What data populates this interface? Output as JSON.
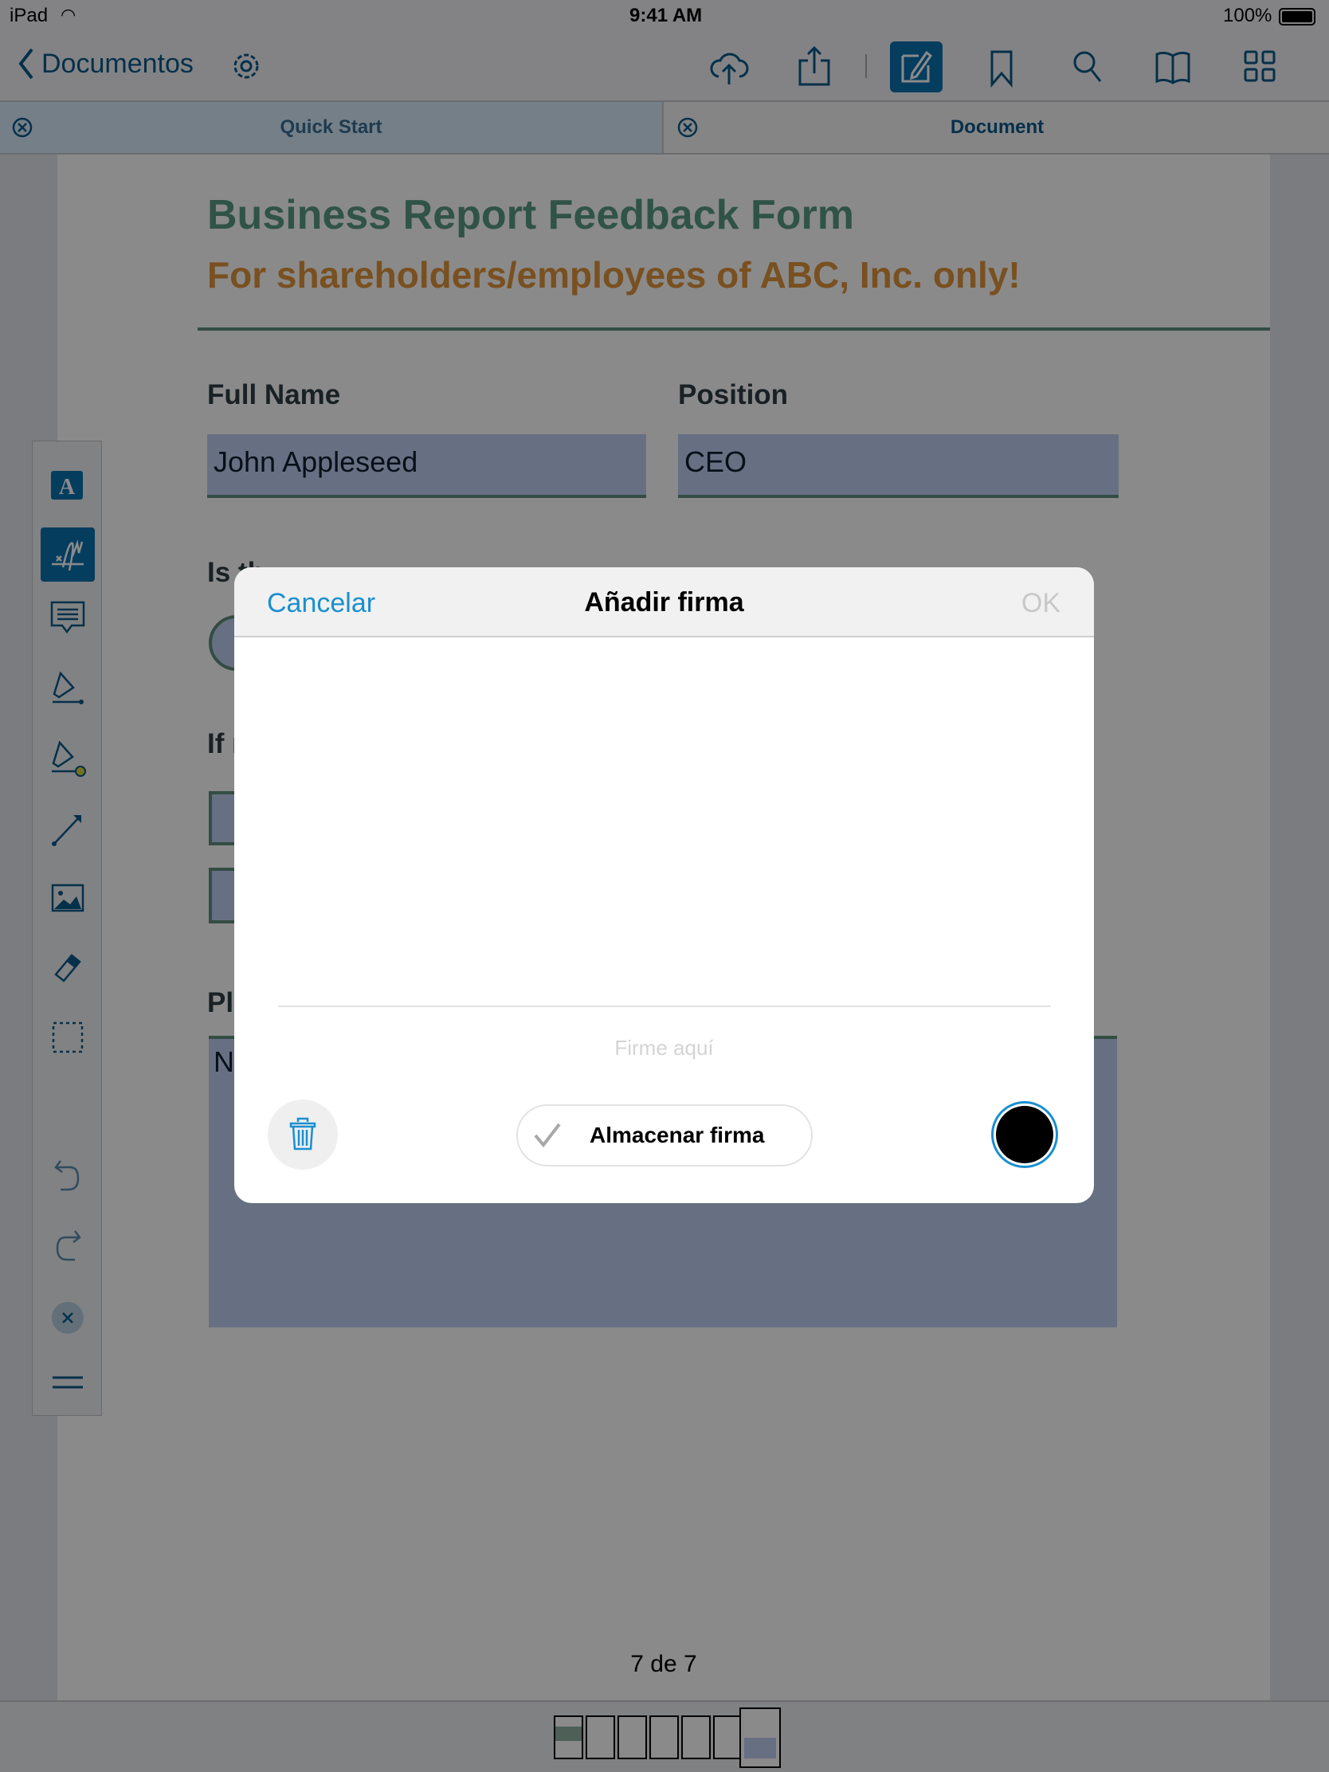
{
  "status": {
    "device": "iPad",
    "time": "9:41 AM",
    "battery": "100%"
  },
  "nav": {
    "back_label": "Documentos",
    "icons": [
      "settings-icon",
      "cloud-upload-icon",
      "share-icon",
      "edit-icon",
      "bookmark-icon",
      "search-icon",
      "book-icon",
      "grid-icon"
    ]
  },
  "tabs": [
    {
      "label": "Quick Start"
    },
    {
      "label": "Document"
    }
  ],
  "document": {
    "title": "Business Report Feedback Form",
    "subtitle": "For shareholders/employees of ABC, Inc. only!",
    "full_name_label": "Full Name",
    "full_name_value": "John Appleseed",
    "position_label": "Position",
    "position_value": "CEO",
    "question1": "Is th",
    "question2": "If r",
    "question3": "Pl",
    "textarea_value": "N",
    "page_indicator": "7 de 7"
  },
  "toolbar": {
    "tools": [
      "text-tool",
      "signature-tool",
      "note-tool",
      "highlighter-tool",
      "highlighter-color-tool",
      "line-tool",
      "image-tool",
      "eraser-tool",
      "selection-tool",
      "undo",
      "redo",
      "close",
      "menu"
    ]
  },
  "thumbnails": {
    "count": 7,
    "selected": 7
  },
  "dialog": {
    "cancel": "Cancelar",
    "title": "Añadir firma",
    "ok": "OK",
    "placeholder": "Firme aquí",
    "store_label": "Almacenar firma",
    "ink_color": "#000000",
    "accent": "#1a8fd0"
  },
  "colors": {
    "accent": "#0b5a8a",
    "title": "#5a9a85",
    "subtitle": "#e0943b",
    "field": "#bfcff3"
  }
}
